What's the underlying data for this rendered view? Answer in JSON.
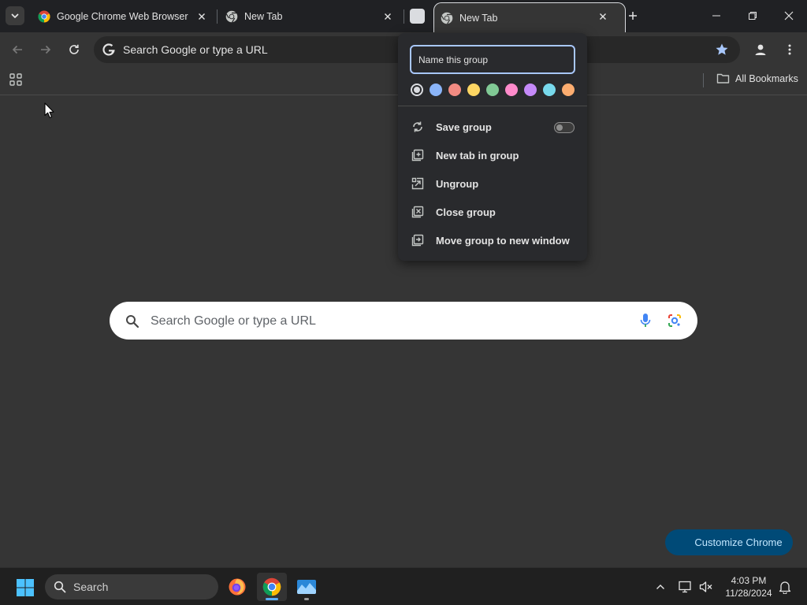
{
  "tabs": [
    {
      "title": "Google Chrome Web Browser",
      "favicon": "chrome-logo-icon",
      "active": false
    },
    {
      "title": "New Tab",
      "favicon": "chrome-icon",
      "active": false
    },
    {
      "title": "New Tab",
      "favicon": "chrome-icon",
      "active": true
    }
  ],
  "tab_group": {
    "color": "#dadce0"
  },
  "toolbar": {
    "omnibox_text": "Search Google or type a URL",
    "icons": [
      "back-arrow-icon",
      "forward-arrow-icon",
      "reload-icon",
      "star-icon",
      "profile-icon",
      "more-vert-icon"
    ]
  },
  "bookmarks_bar": {
    "all_bookmarks_label": "All Bookmarks"
  },
  "group_popup": {
    "name_placeholder": "Name this group",
    "colors": [
      "#dadce0",
      "#8ab4f8",
      "#f28b82",
      "#fdd663",
      "#81c995",
      "#ff8bcb",
      "#c58af9",
      "#78d9ec",
      "#fcad70"
    ],
    "selected_color_index": 0,
    "menu": [
      {
        "label": "Save group",
        "icon": "save-group-icon",
        "has_toggle": true,
        "toggle_on": false
      },
      {
        "label": "New tab in group",
        "icon": "new-tab-in-group-icon"
      },
      {
        "label": "Ungroup",
        "icon": "ungroup-icon"
      },
      {
        "label": "Close group",
        "icon": "close-group-icon"
      },
      {
        "label": "Move group to new window",
        "icon": "move-window-icon"
      }
    ]
  },
  "ntp": {
    "search_placeholder": "Search Google or type a URL",
    "customize_label": "Customize Chrome"
  },
  "taskbar": {
    "search_label": "Search",
    "apps": [
      "firefox-icon",
      "chrome-icon",
      "photos-icon"
    ],
    "active_app_index": 1,
    "time": "4:03 PM",
    "date": "11/28/2024"
  }
}
